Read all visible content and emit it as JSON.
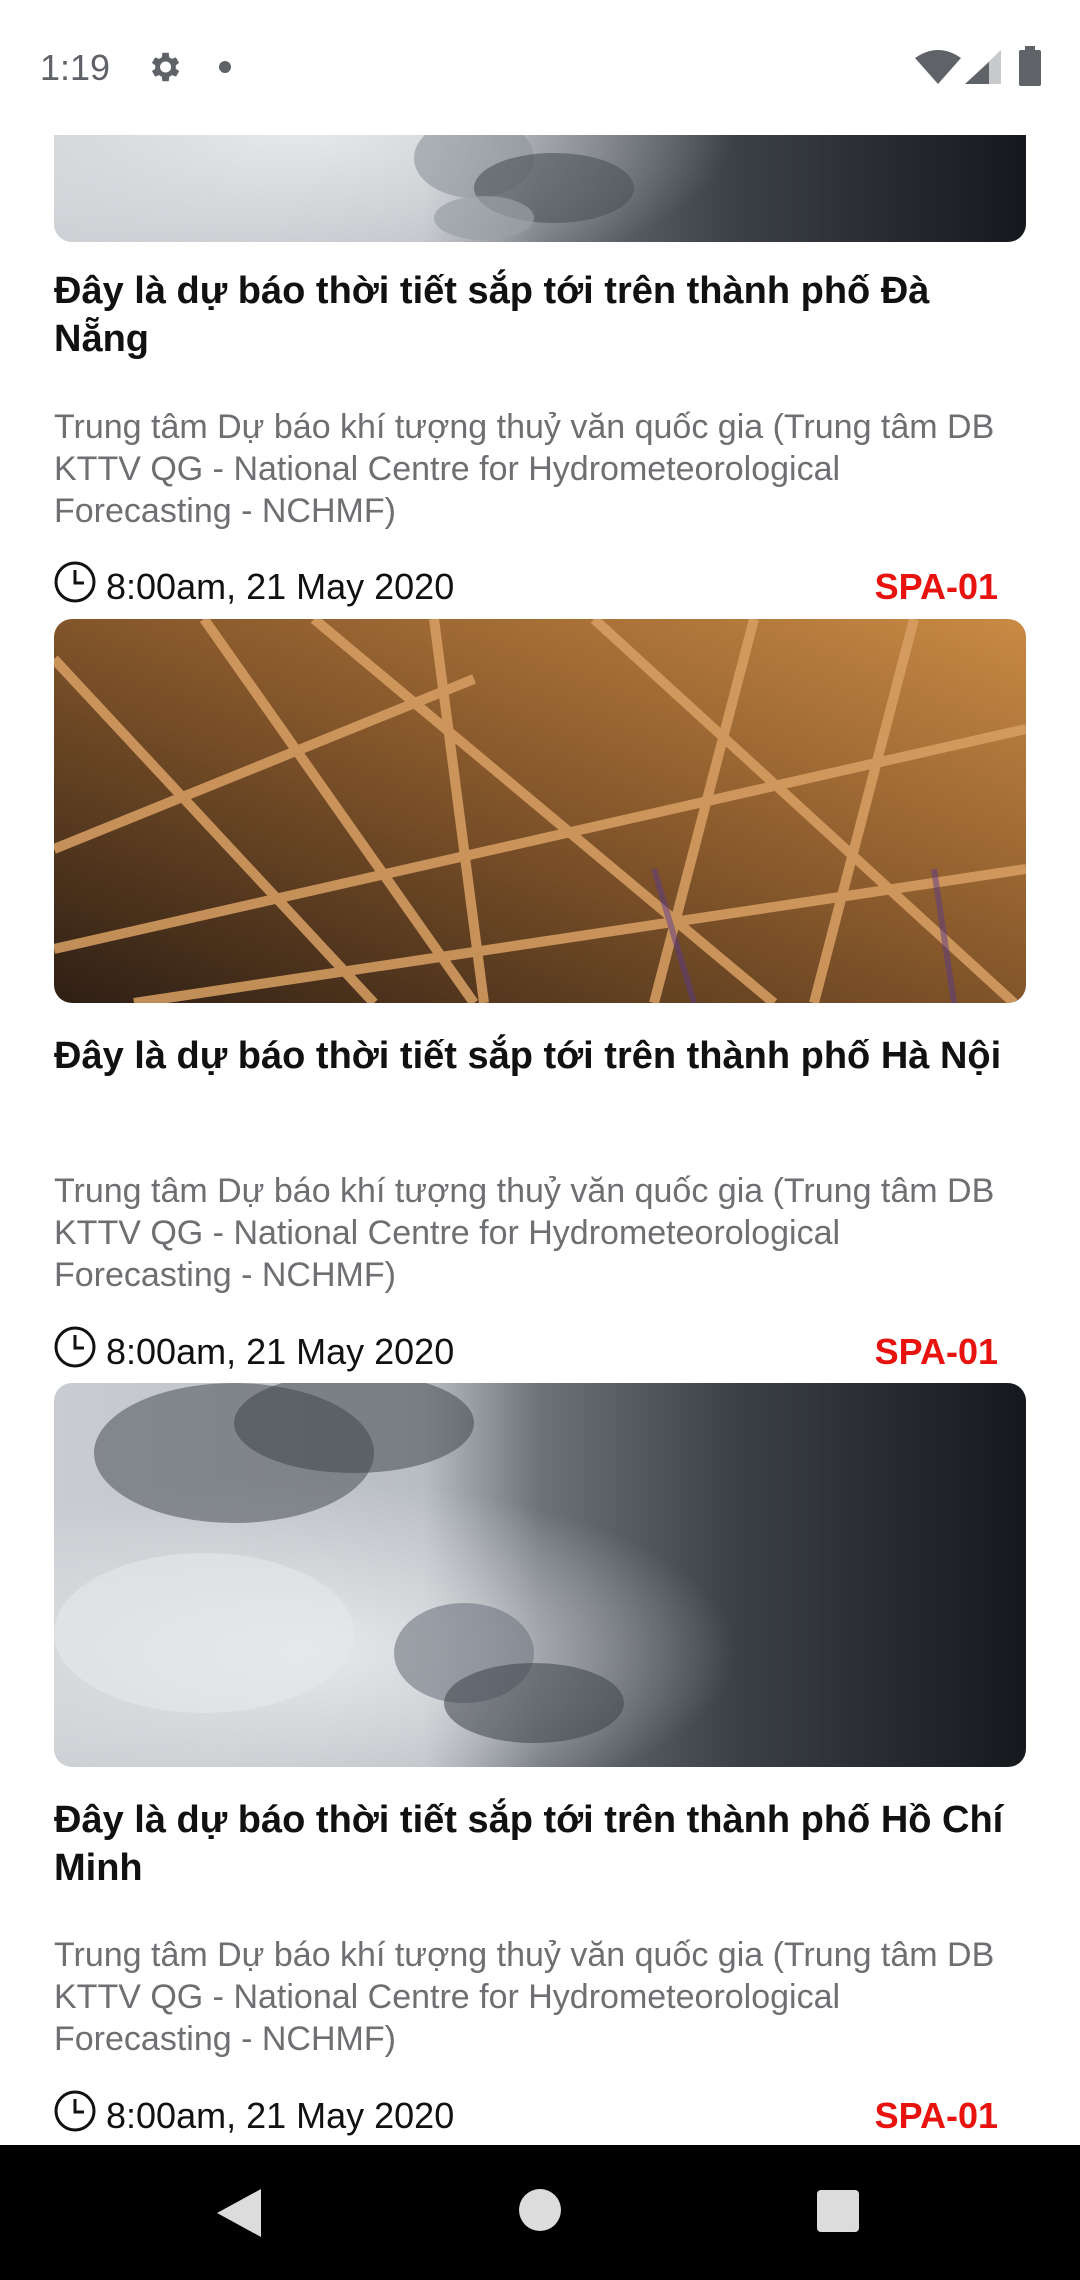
{
  "status_bar": {
    "time": "1:19",
    "icons": [
      "gear-icon",
      "notification-dot-icon",
      "wifi-icon",
      "cell-signal-icon",
      "battery-icon"
    ]
  },
  "feed": {
    "items": [
      {
        "title": "Đây là dự báo thời tiết sắp tới trên thành phố Đà Nẵng",
        "description": "Trung tâm Dự báo khí tượng thuỷ văn quốc gia (Trung tâm DB KTTV QG - National Centre for Hydrometeorological Forecasting - NCHMF)",
        "date": "8:00am, 21 May 2020",
        "code": "SPA-01",
        "image": "storm-clouds"
      },
      {
        "title": "Đây là dự báo thời tiết sắp tới trên thành phố Hà Nội",
        "description": "Trung tâm Dự báo khí tượng thuỷ văn quốc gia (Trung tâm DB KTTV QG - National Centre for Hydrometeorological Forecasting - NCHMF)",
        "date": "8:00am, 21 May 2020",
        "code": "SPA-01",
        "image": "steel-roof-structure"
      },
      {
        "title": "Đây là dự báo thời tiết sắp tới trên thành phố Hồ Chí Minh",
        "description": "Trung tâm Dự báo khí tượng thuỷ văn quốc gia (Trung tâm DB KTTV QG - National Centre for Hydrometeorological Forecasting - NCHMF)",
        "date": "8:00am, 21 May 2020",
        "code": "SPA-01",
        "image": "storm-clouds"
      }
    ]
  },
  "nav_bar": {
    "icons": [
      "back-icon",
      "home-icon",
      "recents-icon"
    ]
  },
  "colors": {
    "code_accent": "#e8130f",
    "description_text": "#6f6f73",
    "title_text": "#111111",
    "nav_background": "#000000"
  }
}
